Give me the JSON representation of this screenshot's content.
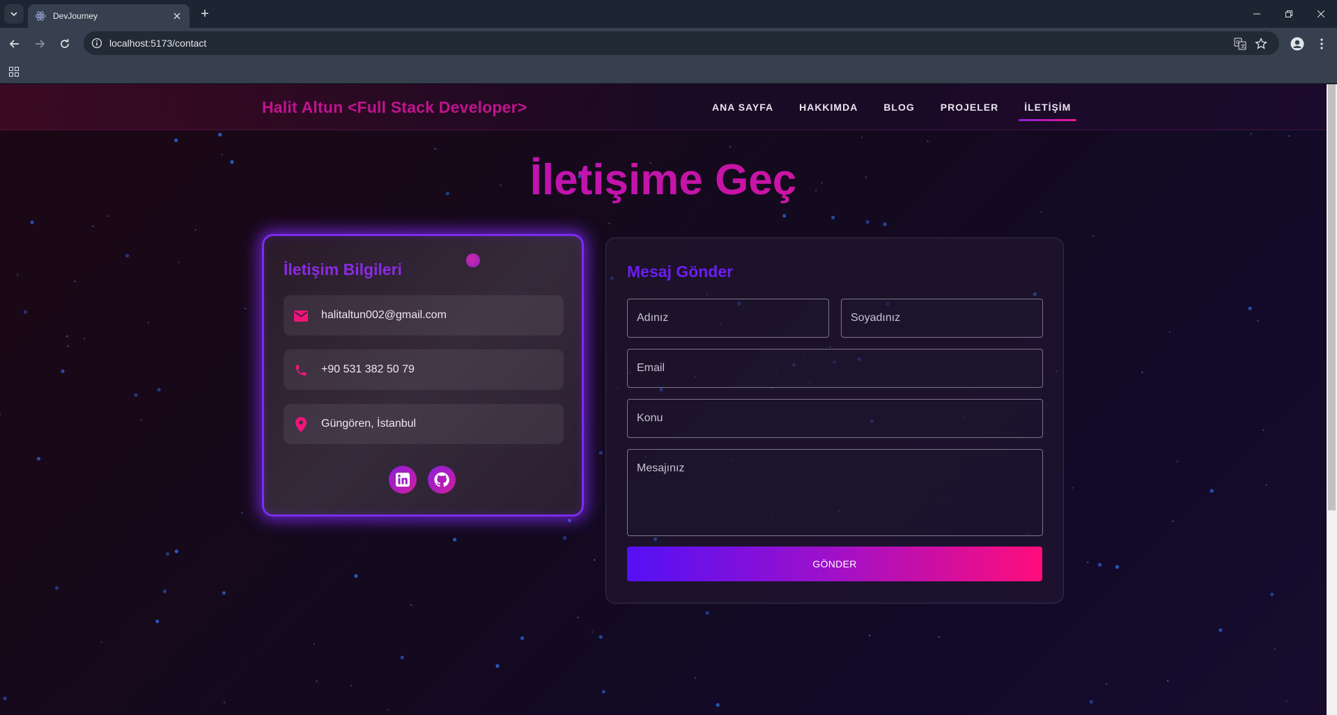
{
  "browser": {
    "tab_title": "DevJourney",
    "new_tab": "+",
    "url": "localhost:5173/contact"
  },
  "site": {
    "brand": "Halit Altun <Full Stack Developer>",
    "nav": [
      {
        "label": "ANA SAYFA",
        "active": false
      },
      {
        "label": "HAKKIMDA",
        "active": false
      },
      {
        "label": "BLOG",
        "active": false
      },
      {
        "label": "PROJELER",
        "active": false
      },
      {
        "label": "İLETİŞİM",
        "active": true
      }
    ],
    "page_title": "İletişime Geç"
  },
  "contact_info": {
    "title": "İletişim Bilgileri",
    "email": "halitaltun002@gmail.com",
    "phone": "+90 531 382 50 79",
    "location": "Güngören, İstanbul",
    "socials": [
      "linkedin-icon",
      "github-icon"
    ]
  },
  "message_form": {
    "title": "Mesaj Gönder",
    "first_name_placeholder": "Adınız",
    "last_name_placeholder": "Soyadınız",
    "email_placeholder": "Email",
    "subject_placeholder": "Konu",
    "message_placeholder": "Mesajınız",
    "submit_label": "GÖNDER"
  },
  "colors": {
    "brand": "#c0148f",
    "accent_purple": "#8a2be2",
    "accent_pink": "#ff0d7a",
    "button_start": "#5410f5"
  }
}
